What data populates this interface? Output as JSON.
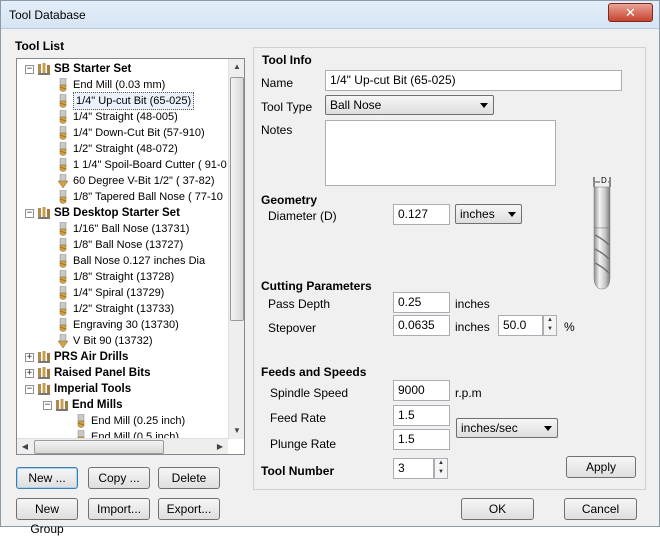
{
  "window": {
    "title": "Tool Database",
    "close_glyph": "✕"
  },
  "tool_list": {
    "label": "Tool List",
    "rows": [
      {
        "text": "SB Starter Set",
        "kind": "group",
        "expander": "−",
        "level": 0
      },
      {
        "text": "End Mill (0.03 mm)",
        "kind": "tool",
        "level": 1
      },
      {
        "text": "1/4\" Up-cut Bit (65-025)",
        "kind": "tool",
        "level": 1,
        "selected": true
      },
      {
        "text": "1/4\" Straight  (48-005)",
        "kind": "tool",
        "level": 1
      },
      {
        "text": "1/4\"  Down-Cut Bit (57-910)",
        "kind": "tool",
        "level": 1
      },
      {
        "text": "1/2\" Straight  (48-072)",
        "kind": "tool",
        "level": 1
      },
      {
        "text": "1 1/4\" Spoil-Board Cutter  ( 91-0",
        "kind": "tool",
        "level": 1
      },
      {
        "text": "60 Degree V-Bit 1/2\"  ( 37-82)",
        "kind": "vbit",
        "level": 1
      },
      {
        "text": "1/8\" Tapered Ball Nose  ( 77-10",
        "kind": "tool",
        "level": 1
      },
      {
        "text": "SB Desktop Starter Set",
        "kind": "group",
        "expander": "−",
        "level": 0
      },
      {
        "text": "1/16\" Ball Nose (13731)",
        "kind": "tool",
        "level": 1
      },
      {
        "text": "1/8\" Ball Nose (13727)",
        "kind": "tool",
        "level": 1
      },
      {
        "text": "Ball Nose 0.127 inches Dia",
        "kind": "tool",
        "level": 1
      },
      {
        "text": "1/8\" Straight (13728)",
        "kind": "tool",
        "level": 1
      },
      {
        "text": "1/4\" Spiral (13729)",
        "kind": "tool",
        "level": 1
      },
      {
        "text": "1/2\" Straight (13733)",
        "kind": "tool",
        "level": 1
      },
      {
        "text": "Engraving 30 (13730)",
        "kind": "tool",
        "level": 1
      },
      {
        "text": "V Bit 90 (13732)",
        "kind": "vbit",
        "level": 1
      },
      {
        "text": "PRS Air Drills",
        "kind": "group",
        "expander": "+",
        "level": 0
      },
      {
        "text": "Raised Panel Bits",
        "kind": "group",
        "expander": "+",
        "level": 0
      },
      {
        "text": "Imperial Tools",
        "kind": "group",
        "expander": "−",
        "level": 0
      },
      {
        "text": "End Mills",
        "kind": "group",
        "expander": "−",
        "level": 1
      },
      {
        "text": "End Mill (0.25 inch)",
        "kind": "tool",
        "level": 2
      },
      {
        "text": "End Mill (0.5 inch)",
        "kind": "tool",
        "level": 2
      }
    ]
  },
  "buttons": {
    "new": "New ...",
    "copy": "Copy ...",
    "delete": "Delete",
    "new_group": "New Group",
    "import": "Import...",
    "export": "Export...",
    "apply": "Apply",
    "ok": "OK",
    "cancel": "Cancel"
  },
  "tool_info": {
    "label": "Tool Info",
    "name_label": "Name",
    "name_value": "1/4\" Up-cut Bit (65-025)",
    "type_label": "Tool Type",
    "type_value": "Ball Nose",
    "notes_label": "Notes",
    "notes_value": ""
  },
  "geometry": {
    "label": "Geometry",
    "diameter_label": "Diameter (D)",
    "diameter_value": "0.127",
    "units_value": "inches",
    "diagram_label": "D"
  },
  "cutting": {
    "label": "Cutting Parameters",
    "pass_depth_label": "Pass Depth",
    "pass_depth_value": "0.25",
    "pass_depth_units": "inches",
    "stepover_label": "Stepover",
    "stepover_value": "0.0635",
    "stepover_units": "inches",
    "stepover_percent": "50.0",
    "percent_sign": "%"
  },
  "feeds": {
    "label": "Feeds and Speeds",
    "spindle_label": "Spindle Speed",
    "spindle_value": "9000",
    "spindle_units": "r.p.m",
    "feed_label": "Feed Rate",
    "feed_value": "1.5",
    "plunge_label": "Plunge Rate",
    "plunge_value": "1.5",
    "rate_units": "inches/sec"
  },
  "tool_number": {
    "label": "Tool Number",
    "value": "3"
  }
}
